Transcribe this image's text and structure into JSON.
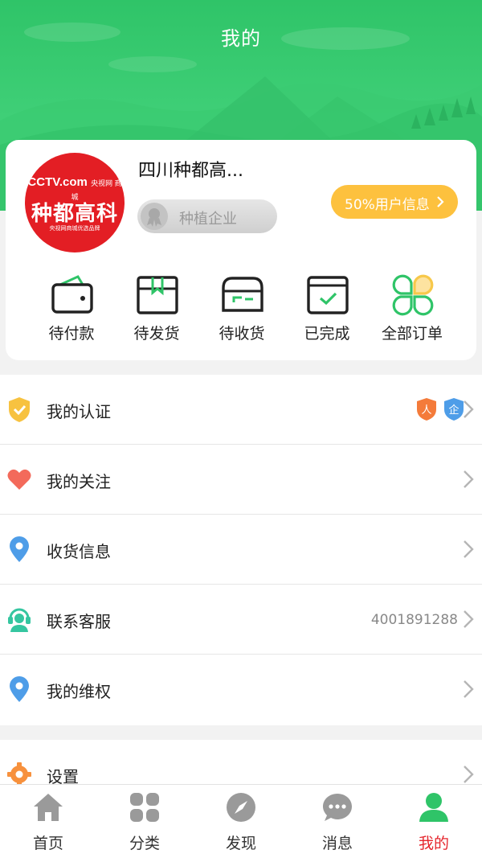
{
  "header": {
    "title": "我的"
  },
  "profile": {
    "name": "四川种都高...",
    "logo": {
      "brand": "CCTV.com",
      "brand_small": "央视网 商城",
      "name": "种都高科",
      "sub": "央视网商城优选品牌"
    },
    "tag": "种植企业",
    "info_button": "50%用户信息"
  },
  "orders": [
    {
      "label": "待付款",
      "icon": "wallet-icon"
    },
    {
      "label": "待发货",
      "icon": "box-icon"
    },
    {
      "label": "待收货",
      "icon": "truck-card-icon"
    },
    {
      "label": "已完成",
      "icon": "check-box-icon"
    },
    {
      "label": "全部订单",
      "icon": "clover-icon"
    }
  ],
  "menu": [
    {
      "label": "我的认证",
      "icon": "shield-check-icon",
      "badges": [
        "人",
        "企"
      ]
    },
    {
      "label": "我的关注",
      "icon": "heart-icon"
    },
    {
      "label": "收货信息",
      "icon": "location-pin-icon"
    },
    {
      "label": "联系客服",
      "icon": "headset-icon",
      "right_text": "4001891288"
    },
    {
      "label": "我的维权",
      "icon": "location-pin-icon"
    },
    {
      "label": "设置",
      "icon": "gear-icon"
    }
  ],
  "tabs": [
    {
      "label": "首页",
      "icon": "home-icon"
    },
    {
      "label": "分类",
      "icon": "grid-icon"
    },
    {
      "label": "发现",
      "icon": "compass-icon"
    },
    {
      "label": "消息",
      "icon": "chat-icon"
    },
    {
      "label": "我的",
      "icon": "person-icon",
      "active": true
    }
  ],
  "colors": {
    "green": "#3ecf76",
    "accent_red": "#e5262d",
    "yellow": "#fdc13e",
    "icon_green": "#2fc468"
  }
}
